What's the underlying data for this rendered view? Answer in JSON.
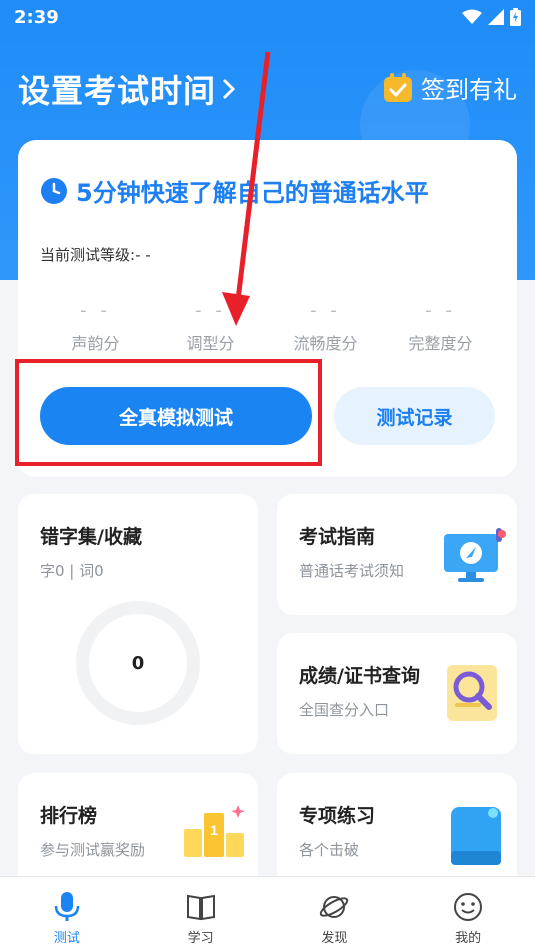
{
  "status_bar": {
    "time": "2:39"
  },
  "header": {
    "title": "设置考试时间",
    "checkin_label": "签到有礼"
  },
  "test_card": {
    "title": "5分钟快速了解自己的普通话水平",
    "level_label": "当前测试等级:",
    "level_value": "- -",
    "scores": [
      {
        "label": "声韵分",
        "value": "- -"
      },
      {
        "label": "调型分",
        "value": "- -"
      },
      {
        "label": "流畅度分",
        "value": "- -"
      },
      {
        "label": "完整度分",
        "value": "- -"
      }
    ],
    "primary_button": "全真模拟测试",
    "secondary_button": "测试记录"
  },
  "cards": {
    "wrong_words": {
      "title": "错字集/收藏",
      "subtitle": "字0 | 词0",
      "count": "0"
    },
    "exam_guide": {
      "title": "考试指南",
      "subtitle": "普通话考试须知"
    },
    "score_query": {
      "title": "成绩/证书查询",
      "subtitle": "全国查分入口"
    },
    "ranking": {
      "title": "排行榜",
      "subtitle": "参与测试赢奖励"
    },
    "practice": {
      "title": "专项练习",
      "subtitle": "各个击破"
    }
  },
  "tabs": [
    {
      "label": "测试",
      "icon": "microphone-icon",
      "active": true
    },
    {
      "label": "学习",
      "icon": "book-icon",
      "active": false
    },
    {
      "label": "发现",
      "icon": "planet-icon",
      "active": false
    },
    {
      "label": "我的",
      "icon": "smiley-icon",
      "active": false
    }
  ],
  "colors": {
    "primary": "#1a84f2",
    "annotation": "#e8202a",
    "background": "#f3f5f8"
  }
}
